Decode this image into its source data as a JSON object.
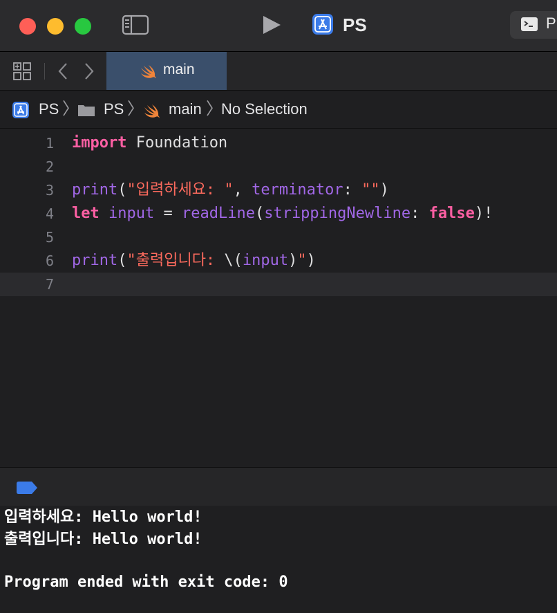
{
  "toolbar": {
    "scheme_name": "PS",
    "destination_label": "P"
  },
  "tabs": [
    {
      "label": "main",
      "active": true
    }
  ],
  "jumpbar": {
    "project": "PS",
    "folder": "PS",
    "file": "main",
    "symbol": "No Selection"
  },
  "editor": {
    "lines": [
      {
        "n": "1",
        "tokens": [
          [
            "kw",
            "import"
          ],
          [
            "plain",
            " Foundation"
          ]
        ]
      },
      {
        "n": "2",
        "tokens": []
      },
      {
        "n": "3",
        "tokens": [
          [
            "fn",
            "print"
          ],
          [
            "plain",
            "("
          ],
          [
            "str",
            "\"입력하세요: \""
          ],
          [
            "plain",
            ", "
          ],
          [
            "fn",
            "terminator"
          ],
          [
            "plain",
            ": "
          ],
          [
            "str",
            "\"\""
          ],
          [
            "plain",
            ")"
          ]
        ]
      },
      {
        "n": "4",
        "tokens": [
          [
            "kw",
            "let"
          ],
          [
            "plain",
            " "
          ],
          [
            "fn",
            "input"
          ],
          [
            "plain",
            " = "
          ],
          [
            "fn",
            "readLine"
          ],
          [
            "plain",
            "("
          ],
          [
            "fn",
            "strippingNewline"
          ],
          [
            "plain",
            ": "
          ],
          [
            "kw",
            "false"
          ],
          [
            "plain",
            ")!"
          ]
        ]
      },
      {
        "n": "5",
        "tokens": []
      },
      {
        "n": "6",
        "tokens": [
          [
            "fn",
            "print"
          ],
          [
            "plain",
            "("
          ],
          [
            "str",
            "\"출력입니다: "
          ],
          [
            "plain",
            "\\("
          ],
          [
            "fn",
            "input"
          ],
          [
            "plain",
            ")"
          ],
          [
            "str",
            "\""
          ],
          [
            "plain",
            ")"
          ]
        ]
      },
      {
        "n": "7",
        "tokens": [],
        "current": true
      }
    ]
  },
  "console": {
    "lines": [
      "입력하세요: Hello world!",
      "출력입니다: Hello world!",
      "",
      "Program ended with exit code: 0"
    ]
  },
  "colors": {
    "keyword": "#fc5fa3",
    "function": "#a167e6",
    "string": "#fc6a5d",
    "close": "#ff5f57",
    "minimize": "#febc2e",
    "zoom": "#28c840",
    "accent": "#3b7be8"
  }
}
